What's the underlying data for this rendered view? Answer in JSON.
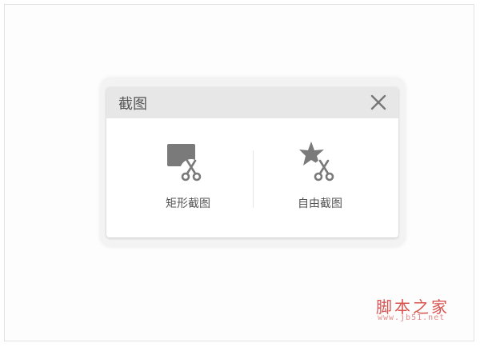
{
  "dialog": {
    "title": "截图",
    "close_icon": "close-icon",
    "options": [
      {
        "label": "矩形截图",
        "icon": "rectangle-scissors-icon"
      },
      {
        "label": "自由截图",
        "icon": "star-scissors-icon"
      }
    ]
  },
  "watermark": {
    "main": "脚本之家",
    "sub": "www.jb51.net"
  },
  "colors": {
    "header_bg": "#e7e7e7",
    "icon_gray": "#7a7a7a",
    "text_gray": "#555555",
    "watermark_red": "#d9534f"
  }
}
